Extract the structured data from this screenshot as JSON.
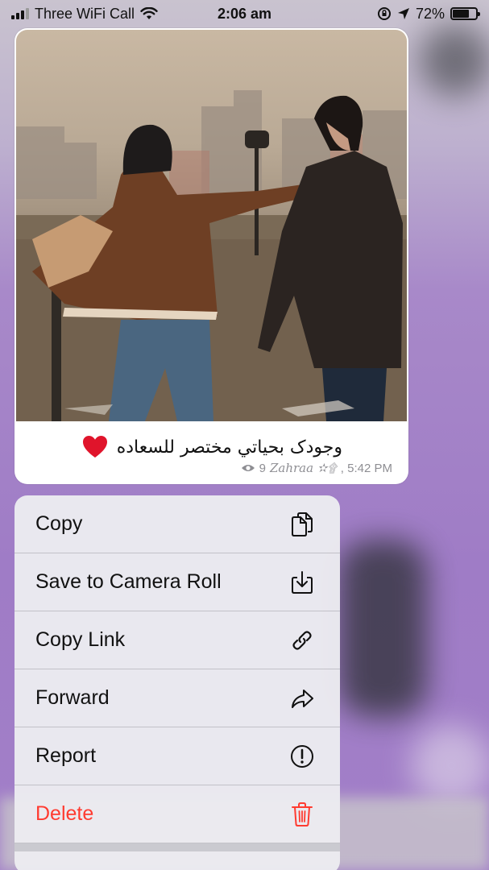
{
  "status_bar": {
    "carrier": "Three WiFi Call",
    "time": "2:06 am",
    "battery": "72%",
    "battery_level": 0.72,
    "icons": [
      "signal-icon",
      "wifi-icon",
      "orientation-lock-icon",
      "location-icon",
      "battery-icon"
    ]
  },
  "message": {
    "caption": "وجودک بحياتي مختصر للسعاده",
    "emoji": "red-heart-icon",
    "views": "9",
    "author": "Zahraa ✫۩",
    "time": ", 5:42 PM",
    "photo_alt": "couple-on-rooftop-photo"
  },
  "menu": {
    "items": [
      {
        "label": "Copy",
        "icon": "copy-icon"
      },
      {
        "label": "Save to Camera Roll",
        "icon": "download-icon"
      },
      {
        "label": "Copy Link",
        "icon": "link-icon"
      },
      {
        "label": "Forward",
        "icon": "forward-arrow-icon"
      },
      {
        "label": "Report",
        "icon": "exclamation-circle-icon"
      },
      {
        "label": "Delete",
        "icon": "trash-icon"
      }
    ]
  },
  "colors": {
    "destructive": "#ff3b30",
    "meta_text": "#8e8e93",
    "menu_bg": "#ececf0",
    "backdrop": "#a27fc8"
  }
}
